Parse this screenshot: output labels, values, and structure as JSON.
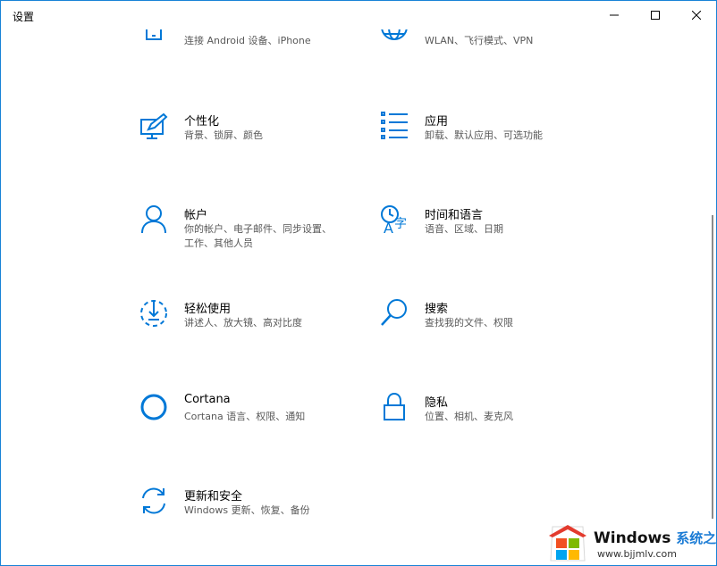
{
  "window": {
    "title": "设置",
    "accent": "#0078d7",
    "controls": {
      "minimize": "minimize-icon",
      "maximize": "maximize-icon",
      "close": "close-icon"
    }
  },
  "tiles": [
    {
      "name": "",
      "desc": "连接 Android 设备、iPhone",
      "icon": "phone-icon"
    },
    {
      "name": "",
      "desc": "WLAN、飞行模式、VPN",
      "icon": "globe-icon"
    },
    {
      "name": "个性化",
      "desc": "背景、锁屏、颜色",
      "icon": "personalization-icon"
    },
    {
      "name": "应用",
      "desc": "卸载、默认应用、可选功能",
      "icon": "apps-list-icon"
    },
    {
      "name": "帐户",
      "desc": "你的帐户、电子邮件、同步设置、工作、其他人员",
      "icon": "person-icon"
    },
    {
      "name": "时间和语言",
      "desc": "语音、区域、日期",
      "icon": "time-language-icon"
    },
    {
      "name": "轻松使用",
      "desc": "讲述人、放大镜、高对比度",
      "icon": "ease-of-access-icon"
    },
    {
      "name": "搜索",
      "desc": "查找我的文件、权限",
      "icon": "search-icon"
    },
    {
      "name": "Cortana",
      "desc": "Cortana 语言、权限、通知",
      "icon": "cortana-icon"
    },
    {
      "name": "隐私",
      "desc": "位置、相机、麦克风",
      "icon": "lock-icon"
    },
    {
      "name": "更新和安全",
      "desc": "Windows 更新、恢复、备份",
      "icon": "update-icon"
    }
  ],
  "watermark": {
    "brand": "Windows",
    "brand_cn": "系统之家",
    "url": "www.bjjmlv.com",
    "icon": "windows-logo-icon"
  }
}
